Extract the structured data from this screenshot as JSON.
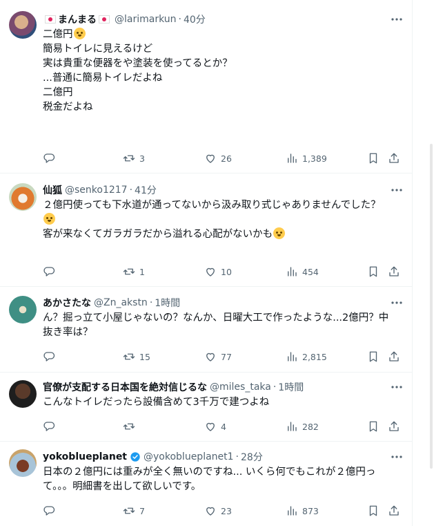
{
  "colors": {
    "secondary_text": "#536471",
    "primary_text": "#0f1419",
    "divider": "#eff3f4",
    "verified": "#1d9bf0"
  },
  "tweets": [
    {
      "name": "まんまる",
      "handle": "@larimarkun",
      "time": "40分",
      "lines": [
        "二億円",
        "簡易トイレに見えるけど",
        "実は貴重な便器をや塗装を使ってるとか？",
        "...普通に簡易トイレだよね",
        "",
        "二億円",
        "",
        "税金だよね"
      ],
      "replies": "",
      "retweets": "3",
      "likes": "26",
      "views": "1,389"
    },
    {
      "name": "仙狐",
      "handle": "@senko1217",
      "time": "41分",
      "lines": [
        "２億円使っても下水道が通ってないから汲み取り式じゃありませんでした？",
        "",
        "",
        "客が来なくてガラガラだから溢れる心配がないかも"
      ],
      "replies": "",
      "retweets": "1",
      "likes": "10",
      "views": "454"
    },
    {
      "name": "あかさたな",
      "handle": "@Zn_akstn",
      "time": "1時間",
      "lines": [
        "ん？掘っ立て小屋じゃないの？なんか、日曜大工で作ったような...2億円？中",
        "抜き率は？"
      ],
      "replies": "",
      "retweets": "15",
      "likes": "77",
      "views": "2,815"
    },
    {
      "name": "官僚が支配する日本国を絶対信じるな",
      "handle": "@miles_taka",
      "time": "1時間",
      "lines": [
        "こんなトイレだったら設備含めて3千万で建つよね"
      ],
      "replies": "",
      "retweets": "",
      "likes": "4",
      "views": "282"
    },
    {
      "name": "yokoblueplanet",
      "handle": "@yokoblueplanet1",
      "time": "28分",
      "lines": [
        "日本の２億円には重みが全く無いのですね... いくら何でもこれが２億円っ",
        "て。。。明細書を出して欲しいです。"
      ],
      "replies": "",
      "retweets": "7",
      "likes": "23",
      "views": "873"
    }
  ]
}
